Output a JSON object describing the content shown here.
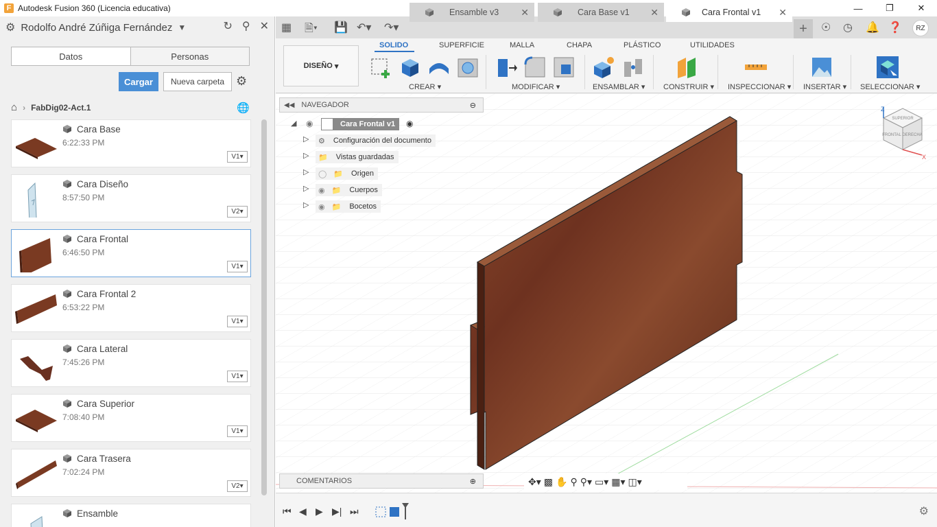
{
  "window": {
    "title": "Autodesk Fusion 360 (Licencia educativa)"
  },
  "data_panel": {
    "user": "Rodolfo André Zúñiga Fernández",
    "tabs": [
      "Datos",
      "Personas"
    ],
    "upload_label": "Cargar",
    "new_folder_label": "Nueva carpeta",
    "breadcrumb": "FabDig02-Act.1",
    "files": [
      {
        "name": "Cara Base",
        "time": "6:22:33 PM",
        "version": "V1"
      },
      {
        "name": "Cara Diseño",
        "time": "8:57:50 PM",
        "version": "V2"
      },
      {
        "name": "Cara Frontal",
        "time": "6:46:50 PM",
        "version": "V1"
      },
      {
        "name": "Cara Frontal 2",
        "time": "6:53:22 PM",
        "version": "V1"
      },
      {
        "name": "Cara Lateral",
        "time": "7:45:26 PM",
        "version": "V1"
      },
      {
        "name": "Cara Superior",
        "time": "7:08:40 PM",
        "version": "V1"
      },
      {
        "name": "Cara Trasera",
        "time": "7:02:24 PM",
        "version": "V2"
      },
      {
        "name": "Ensamble",
        "time": "",
        "version": ""
      }
    ]
  },
  "doc_tabs": [
    "Ensamble v3",
    "Cara Base v1",
    "Cara Frontal v1"
  ],
  "toolbar": {
    "workspace": "DISEÑO",
    "ribbon_tabs": [
      "SOLIDO",
      "SUPERFICIE",
      "MALLA",
      "CHAPA",
      "PLÁSTICO",
      "UTILIDADES"
    ],
    "groups": [
      "CREAR",
      "MODIFICAR",
      "ENSAMBLAR",
      "CONSTRUIR",
      "INSPECCIONAR",
      "INSERTAR",
      "SELECCIONAR"
    ]
  },
  "browser": {
    "title": "NAVEGADOR",
    "root": "Cara Frontal v1",
    "items": [
      "Configuración del documento",
      "Vistas guardadas",
      "Origen",
      "Cuerpos",
      "Bocetos"
    ]
  },
  "comments_label": "COMENTARIOS",
  "viewcube": {
    "faces": [
      "SUPERIOR",
      "FRONTAL",
      "DERECHA"
    ],
    "axes": [
      "Z",
      "X"
    ]
  },
  "colors": {
    "accent": "#2f73c4",
    "upload_button": "#4a8fd6",
    "wood": "#7a3a22"
  }
}
